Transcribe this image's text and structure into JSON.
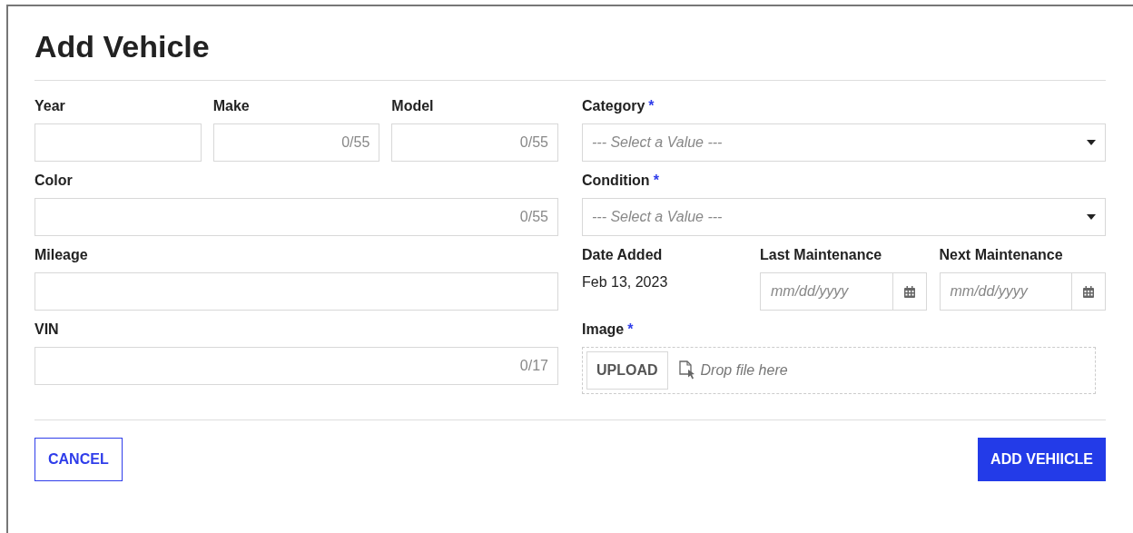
{
  "title": "Add Vehicle",
  "left": {
    "top_row": [
      {
        "label": "Year"
      },
      {
        "label": "Make",
        "counter": "0/55"
      },
      {
        "label": "Model",
        "counter": "0/55"
      }
    ],
    "fields": [
      {
        "label": "Color",
        "counter": "0/55"
      },
      {
        "label": "Mileage"
      },
      {
        "label": "VIN",
        "counter": "0/17"
      }
    ]
  },
  "right": {
    "selects": [
      {
        "label": "Category",
        "marker": "*",
        "placeholder": "--- Select a Value ---"
      },
      {
        "label": "Condition",
        "marker": "*",
        "placeholder": "--- Select a Value ---"
      }
    ],
    "date_added": {
      "label": "Date Added",
      "value": "Feb 13, 2023"
    },
    "date_fields": [
      {
        "label": "Last Maintenance",
        "placeholder": "mm/dd/yyyy"
      },
      {
        "label": "Next Maintenance",
        "placeholder": "mm/dd/yyyy"
      }
    ],
    "image": {
      "label": "Image",
      "marker": "*",
      "button": "UPLOAD",
      "hint": "Drop file here"
    }
  },
  "buttons": {
    "cancel": "CANCEL",
    "submit": "ADD VEHIICLE"
  }
}
